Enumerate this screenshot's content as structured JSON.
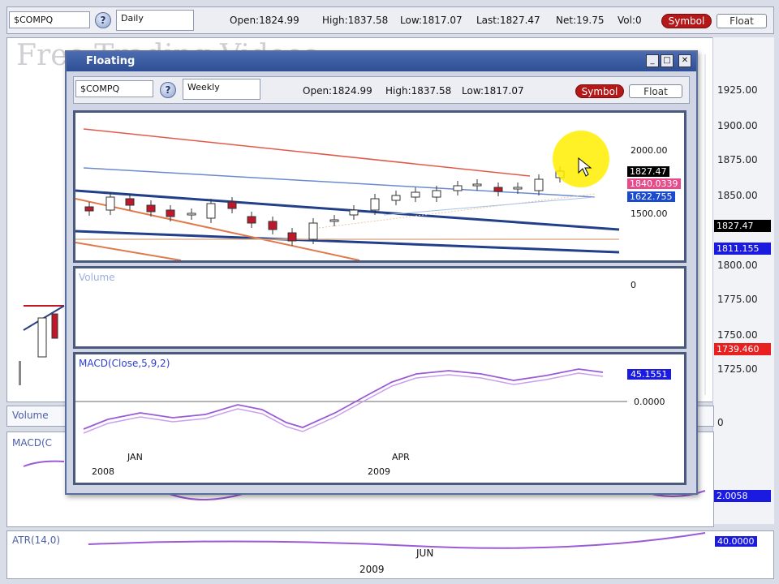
{
  "background": {
    "toolbar": {
      "symbol": "$COMPQ",
      "help": "?",
      "interval": "Daily",
      "open": "Open:1824.99",
      "high": "High:1837.58",
      "low": "Low:1817.07",
      "last": "Last:1827.47",
      "net": "Net:19.75",
      "vol": "Vol:0",
      "symbol_btn": "Symbol",
      "float_btn": "Float"
    },
    "watermark": "Free Trading Videos",
    "price_axis": [
      "1925.00",
      "1900.00",
      "1875.00",
      "1850.00",
      "1800.00",
      "1775.00",
      "1750.00",
      "1725.00"
    ],
    "price_tags": [
      {
        "text": "1827.47",
        "bg": "#000000",
        "fg": "#ffffff"
      },
      {
        "text": "1811.155",
        "bg": "#1a1ae0",
        "fg": "#ffffff"
      },
      {
        "text": "1739.460",
        "bg": "#e82020",
        "fg": "#ffffff"
      }
    ],
    "volume_label": "Volume",
    "volume_zero": "0",
    "macd_label": "MACD(C",
    "macd_tag": "2.0058",
    "atr_label": "ATR(14,0)",
    "atr_month": "JUN",
    "atr_year": "2009",
    "atr_tag": "40.0000"
  },
  "float_window": {
    "title": "Floating",
    "toolbar": {
      "symbol": "$COMPQ",
      "help": "?",
      "interval": "Weekly",
      "open": "Open:1824.99",
      "high": "High:1837.58",
      "low": "Low:1817.07",
      "symbol_btn": "Symbol",
      "float_btn": "Float"
    },
    "price_axis": [
      "2000.00",
      "1500.00"
    ],
    "price_tags": [
      {
        "text": "1827.47",
        "bg": "#000000",
        "fg": "#ffffff"
      },
      {
        "text": "1840.0339",
        "bg": "#e84a8a",
        "fg": "#ffffff"
      },
      {
        "text": "1622.755",
        "bg": "#1a4ad0",
        "fg": "#ffffff"
      }
    ],
    "volume_label": "Volume",
    "volume_zero": "0",
    "macd_label": "MACD(Close,5,9,2)",
    "macd_tag": "45.1551",
    "macd_zero": "0.0000",
    "x_months": [
      "JAN",
      "APR"
    ],
    "x_years": [
      "2008",
      "2009"
    ]
  },
  "colors": {
    "bull_candle": "#ffffff",
    "bear_candle": "#c0182a",
    "macd_line": "#9b5bd6",
    "highlight": "#ffee00"
  }
}
